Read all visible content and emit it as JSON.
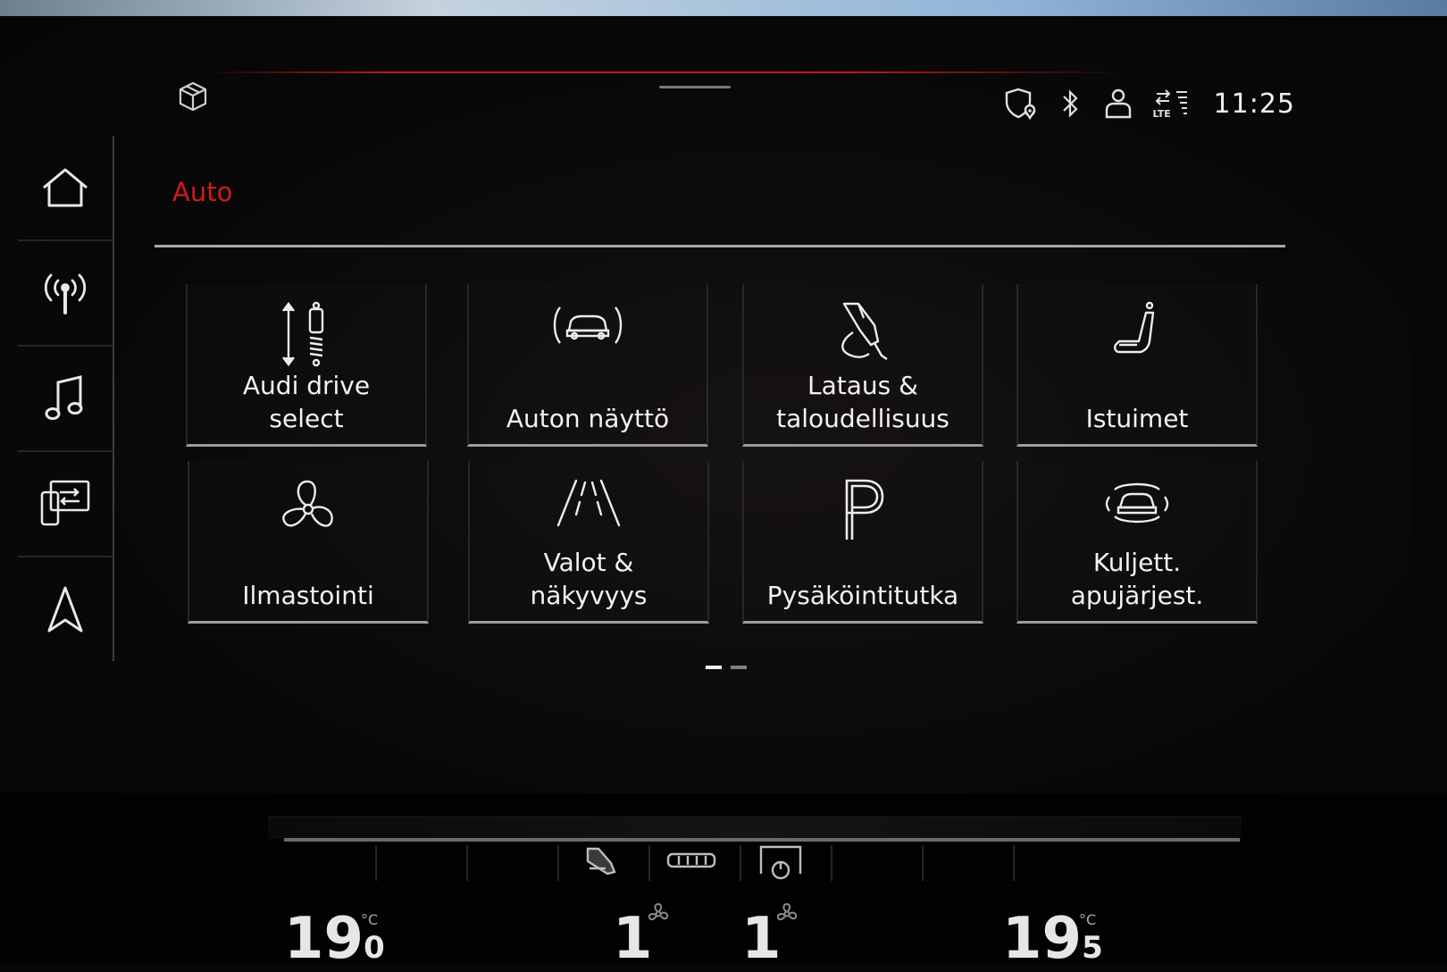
{
  "header": {
    "clock": "11:25",
    "network_label": "LTE"
  },
  "page": {
    "title": "Auto"
  },
  "tiles": [
    {
      "label": "Audi drive\nselect",
      "icon": "suspension-icon"
    },
    {
      "label": "Auton näyttö",
      "icon": "car-display-icon"
    },
    {
      "label": "Lataus &\ntaloudellisuus",
      "icon": "charging-plug-icon"
    },
    {
      "label": "Istuimet",
      "icon": "seat-icon"
    },
    {
      "label": "Ilmastointi",
      "icon": "fan-icon"
    },
    {
      "label": "Valot &\nnäkyvyys",
      "icon": "road-lights-icon"
    },
    {
      "label": "Pysäköintitutka",
      "icon": "parking-icon"
    },
    {
      "label": "Kuljett.\napujärjest.",
      "icon": "driver-assist-icon"
    }
  ],
  "pagination": {
    "current": 1,
    "total": 2
  },
  "climate": {
    "left_temp_int": "19",
    "left_temp_dec": "0",
    "right_temp_int": "19",
    "right_temp_dec": "5",
    "unit": "°C",
    "left_fan": "1",
    "right_fan": "1"
  },
  "colors": {
    "accent": "#d11a1a",
    "text": "#f2f2f2",
    "background": "#070707"
  }
}
